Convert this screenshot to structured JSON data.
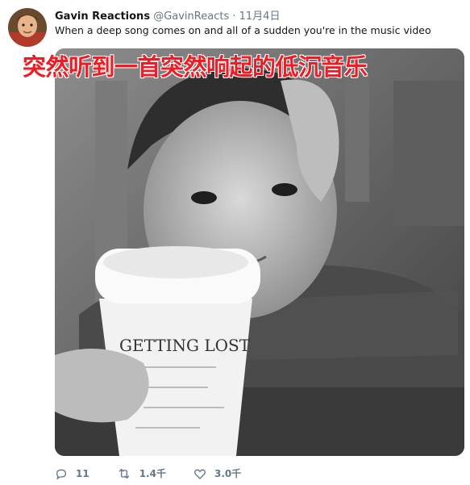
{
  "tweet": {
    "author_name": "Gavin Reactions",
    "author_handle": "@GavinReacts",
    "separator": "·",
    "date": "11月4日",
    "text": "When a deep song comes on and all of a sudden you're in the music video",
    "overlay_caption": "突然听到一首突然响起的低沉音乐",
    "cup_text": "GETTING LOST"
  },
  "actions": {
    "reply_count": "11",
    "retweet_count": "1.4千",
    "like_count": "3.0千"
  },
  "icons": {
    "reply": "reply-icon",
    "retweet": "retweet-icon",
    "like": "heart-icon"
  },
  "colors": {
    "text_primary": "#14171a",
    "text_secondary": "#657786",
    "caption_red": "#ee1c25"
  }
}
